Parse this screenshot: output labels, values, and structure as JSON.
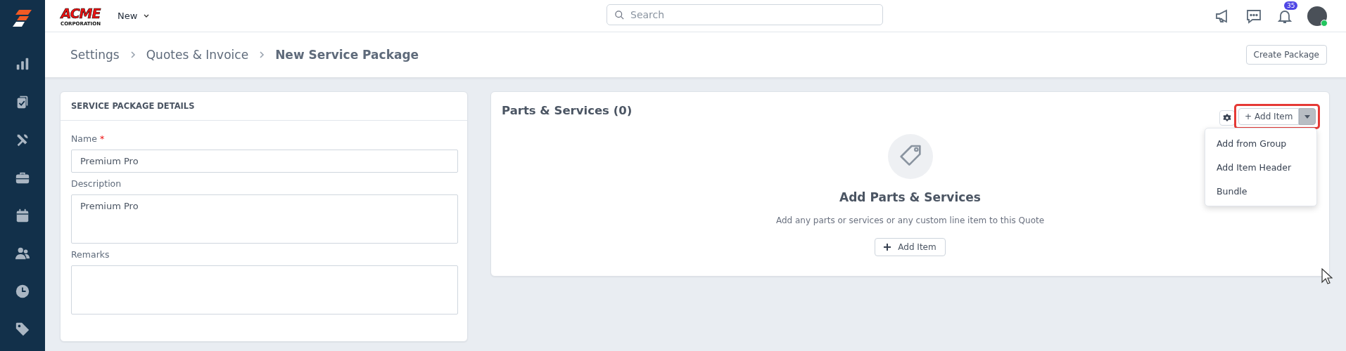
{
  "sidebar": {
    "items": [
      {
        "kind": "chart",
        "selected": false
      },
      {
        "kind": "clipboard",
        "selected": false
      },
      {
        "kind": "tools",
        "selected": false
      },
      {
        "kind": "briefcase",
        "selected": false
      },
      {
        "kind": "calendar",
        "selected": false
      },
      {
        "kind": "users",
        "selected": false
      },
      {
        "kind": "clock",
        "selected": false
      },
      {
        "kind": "tag",
        "selected": false
      }
    ]
  },
  "topbar": {
    "logo": {
      "name": "ACME",
      "sub": "CORPORATION"
    },
    "new_menu": "New",
    "search": {
      "placeholder": "Search"
    },
    "notifications": {
      "count": "35"
    },
    "avatar": {
      "online": true
    }
  },
  "breadcrumb": [
    "Settings",
    "Quotes & Invoice",
    "New Service Package"
  ],
  "create_button": "Create Package",
  "details": {
    "title": "SERVICE PACKAGE DETAILS",
    "fields": [
      {
        "kind": "input",
        "label": "Name",
        "required_mark": "*",
        "value": "Premium Pro"
      },
      {
        "kind": "textarea",
        "label": "Description",
        "value": "Premium Pro"
      },
      {
        "kind": "textarea",
        "label": "Remarks"
      }
    ]
  },
  "parts": {
    "title": "Parts & Services (0)",
    "add_button": {
      "plus": "+",
      "label": "Add Item",
      "highlighted": true,
      "expanded": true
    },
    "menu": [
      "Add from Group",
      "Add Item Header",
      "Bundle"
    ],
    "empty": {
      "heading": "Add Parts & Services",
      "text": "Add any parts or services or any custom line item to this Quote",
      "button": "Add Item"
    }
  }
}
